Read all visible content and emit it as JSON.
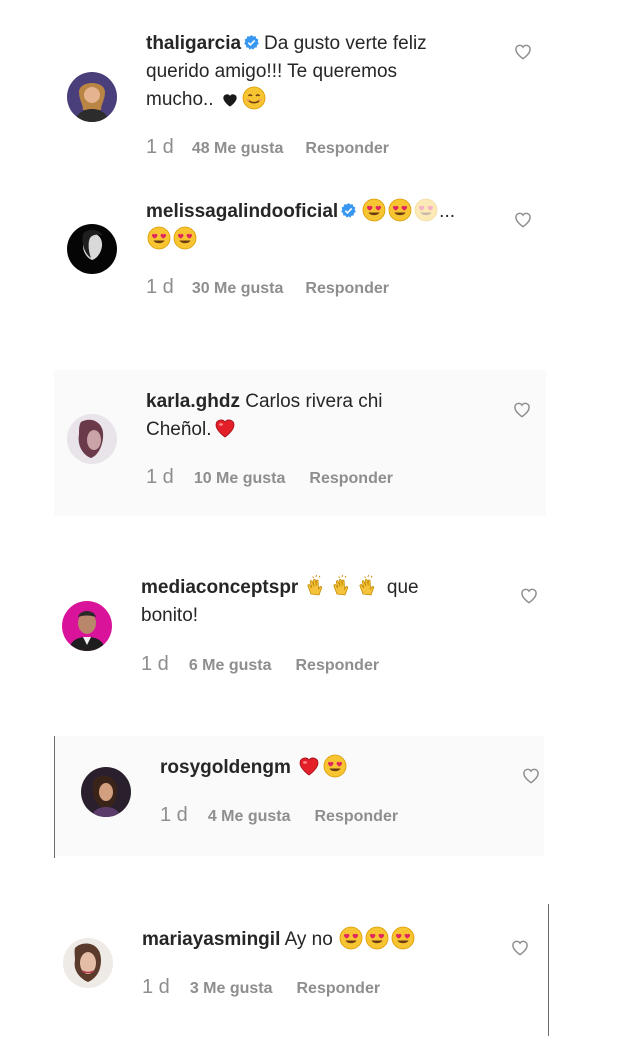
{
  "comments": [
    {
      "username": "thaligarcia",
      "verified": true,
      "text_line1": "Da gusto verte feliz",
      "text_line2": "querido amigo!!! Te queremos",
      "text_line3": "mucho..",
      "time": "1 d",
      "likes": "48 Me gusta",
      "reply": "Responder",
      "emojis": [
        "black-heart-icon",
        "smiling-face-icon"
      ]
    },
    {
      "username": "melissagalindooficial",
      "verified": true,
      "text_line1": "",
      "ellipsis": "...",
      "time": "1 d",
      "likes": "30 Me gusta",
      "reply": "Responder",
      "emojis": [
        "heart-eyes-icon",
        "heart-eyes-icon",
        "heart-eyes-icon",
        "heart-eyes-icon"
      ]
    },
    {
      "username": "karla.ghdz",
      "verified": false,
      "text_line1": "Carlos rivera chi",
      "text_line2": "Cheñol.",
      "time": "1 d",
      "likes": "10 Me gusta",
      "reply": "Responder",
      "emojis": [
        "red-heart-icon"
      ]
    },
    {
      "username": "mediaconceptspr",
      "verified": false,
      "text_line1": "que",
      "text_line2": "bonito!",
      "time": "1 d",
      "likes": "6 Me gusta",
      "reply": "Responder",
      "emojis": [
        "clapping-hands-icon",
        "clapping-hands-icon",
        "clapping-hands-icon"
      ]
    },
    {
      "username": "rosygoldengm",
      "verified": false,
      "text_line1": "",
      "time": "1 d",
      "likes": "4 Me gusta",
      "reply": "Responder",
      "emojis": [
        "red-heart-icon",
        "heart-eyes-icon"
      ]
    },
    {
      "username": "mariayasmingil",
      "verified": false,
      "text_line1": "Ay no",
      "time": "1 d",
      "likes": "3 Me gusta",
      "reply": "Responder",
      "emojis": [
        "heart-eyes-icon",
        "heart-eyes-icon",
        "heart-eyes-icon"
      ]
    }
  ],
  "colors": {
    "text": "#262626",
    "meta": "#8e8e8e",
    "verified": "#3897f0",
    "heart_red": "#ed1c24"
  }
}
